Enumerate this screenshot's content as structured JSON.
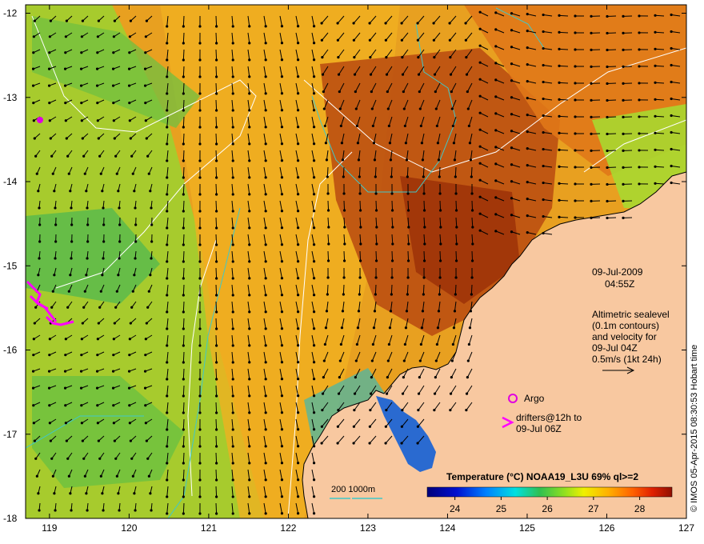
{
  "map": {
    "lon_ticks": [
      "119",
      "120",
      "121",
      "122",
      "123",
      "124",
      "125",
      "126",
      "127"
    ],
    "lat_ticks": [
      "-12",
      "-13",
      "-14",
      "-15",
      "-16",
      "-17",
      "-18"
    ],
    "lon_range": [
      118.7,
      127.0
    ],
    "lat_range": [
      -11.9,
      -18.0
    ]
  },
  "annotations": {
    "date": "09-Jul-2009",
    "time": "04:55Z",
    "altimetry_lines": [
      "Altimetric sealevel",
      "(0.1m contours)",
      "and velocity for",
      "09-Jul 04Z",
      "0.5m/s (1kt 24h)"
    ],
    "argo_label": "Argo",
    "drifters_line1": "drifters@12h to",
    "drifters_line2": "09-Jul 06Z",
    "depth_legend": "200  1000m",
    "credit": "© IMOS 05-Apr-2015 08:30:53 Hobart time"
  },
  "colorbar": {
    "title": "Temperature (°C) NOAA19_L3U 69% ql>=2",
    "ticks": [
      "24",
      "25",
      "26",
      "27",
      "28"
    ],
    "tick_values": [
      24,
      25,
      26,
      27,
      28
    ],
    "range": [
      23.4,
      28.7
    ]
  },
  "colors": {
    "land": "#f8c8a0",
    "argo": "#e000e0",
    "drifter": "#ff00ff",
    "contour_200m": "#40c8c8",
    "sealevel_contour": "#ffffff",
    "vectors": "#000000"
  }
}
